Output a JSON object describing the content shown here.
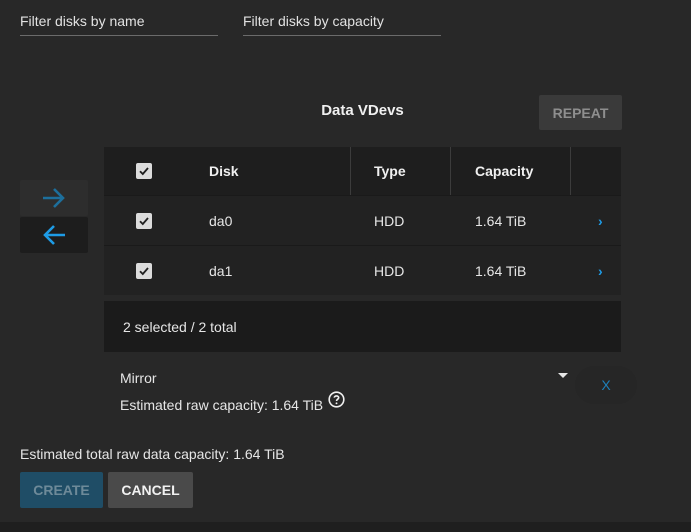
{
  "filters": {
    "name_placeholder": "Filter disks by name",
    "capacity_placeholder": "Filter disks by capacity"
  },
  "vdev": {
    "title": "Data VDevs",
    "repeat_label": "REPEAT",
    "columns": [
      "Disk",
      "Type",
      "Capacity"
    ],
    "rows": [
      {
        "disk": "da0",
        "type": "HDD",
        "capacity": "1.64 TiB",
        "checked": true
      },
      {
        "disk": "da1",
        "type": "HDD",
        "capacity": "1.64 TiB",
        "checked": true
      }
    ],
    "selection_summary": "2 selected / 2 total",
    "layout_value": "Mirror",
    "estimated_raw": "Estimated raw capacity: 1.64 TiB",
    "remove_label": "X"
  },
  "estimated_total": "Estimated total raw data capacity: 1.64 TiB",
  "actions": {
    "create_label": "CREATE",
    "cancel_label": "CANCEL"
  },
  "icons": {
    "move_right": "arrow-right-icon",
    "move_left": "arrow-left-icon",
    "help": "help-circle-icon",
    "row_expand": "chevron-right-icon"
  },
  "colors": {
    "accent": "#1e9ce6",
    "background": "#282828",
    "create_disabled": "#1f4d66"
  }
}
